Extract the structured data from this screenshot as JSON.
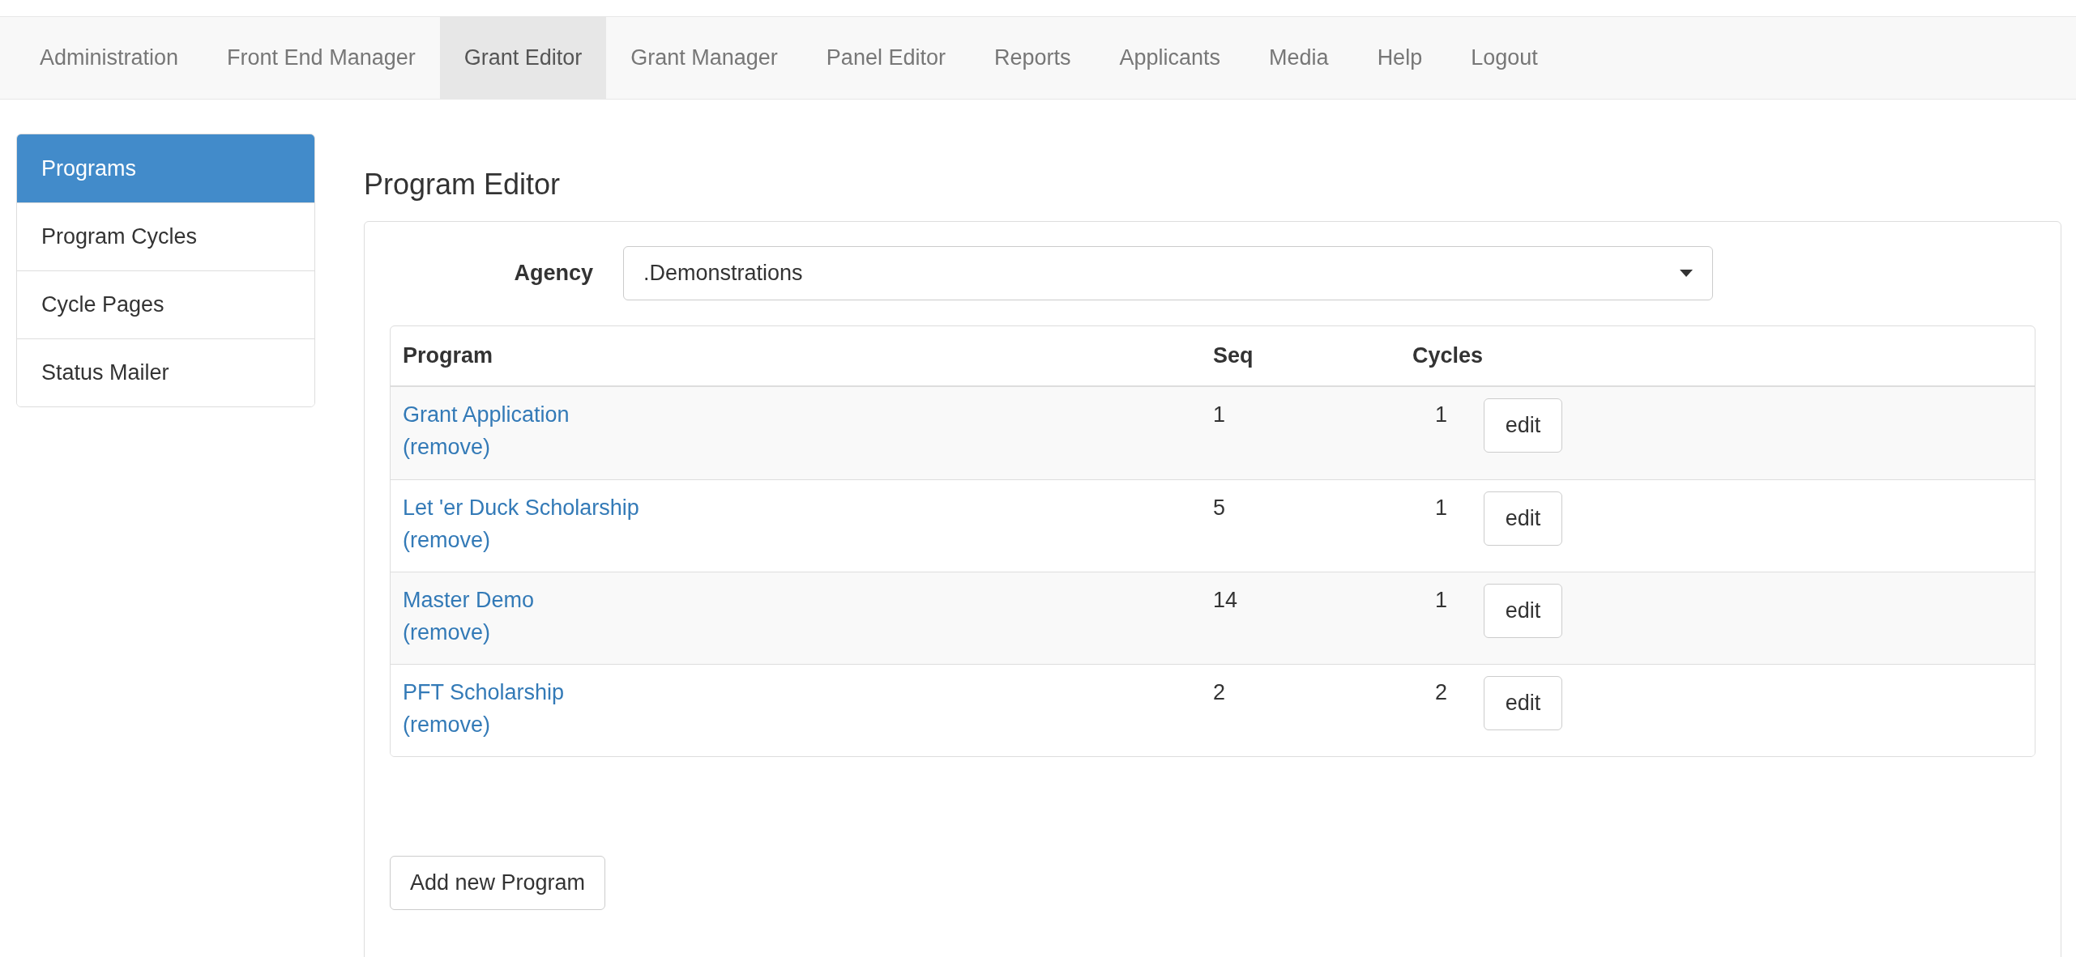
{
  "nav": {
    "tabs": [
      {
        "label": "Administration",
        "selected": false
      },
      {
        "label": "Front End Manager",
        "selected": false
      },
      {
        "label": "Grant Editor",
        "selected": true
      },
      {
        "label": "Grant Manager",
        "selected": false
      },
      {
        "label": "Panel Editor",
        "selected": false
      },
      {
        "label": "Reports",
        "selected": false
      },
      {
        "label": "Applicants",
        "selected": false
      },
      {
        "label": "Media",
        "selected": false
      },
      {
        "label": "Help",
        "selected": false
      },
      {
        "label": "Logout",
        "selected": false
      }
    ]
  },
  "sidebar": {
    "items": [
      {
        "label": "Programs",
        "selected": true
      },
      {
        "label": "Program Cycles",
        "selected": false
      },
      {
        "label": "Cycle Pages",
        "selected": false
      },
      {
        "label": "Status Mailer",
        "selected": false
      }
    ]
  },
  "main": {
    "title": "Program Editor",
    "agency": {
      "label": "Agency",
      "value": ".Demonstrations"
    },
    "table": {
      "columns": [
        "Program",
        "Seq",
        "Cycles"
      ],
      "rows": [
        {
          "program": "Grant Application",
          "remove": "(remove)",
          "seq": "1",
          "cycles": "1",
          "action": "edit"
        },
        {
          "program": "Let 'er Duck Scholarship",
          "remove": "(remove)",
          "seq": "5",
          "cycles": "1",
          "action": "edit"
        },
        {
          "program": "Master Demo",
          "remove": "(remove)",
          "seq": "14",
          "cycles": "1",
          "action": "edit"
        },
        {
          "program": "PFT Scholarship",
          "remove": "(remove)",
          "seq": "2",
          "cycles": "2",
          "action": "edit"
        }
      ]
    },
    "add_button": "Add new Program"
  }
}
